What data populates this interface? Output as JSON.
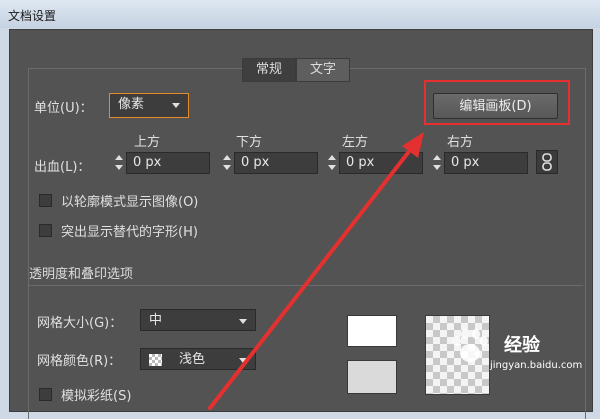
{
  "window": {
    "title": "文档设置"
  },
  "tabs": [
    {
      "label": "常规",
      "active": true
    },
    {
      "label": "文字",
      "active": false
    }
  ],
  "units": {
    "label": "单位(U)：",
    "value": "像素"
  },
  "edit_artboards_button": "编辑画板(D)",
  "bleed": {
    "label": "出血(L)：",
    "columns": [
      {
        "header": "上方",
        "value": "0 px"
      },
      {
        "header": "下方",
        "value": "0 px"
      },
      {
        "header": "左方",
        "value": "0 px"
      },
      {
        "header": "右方",
        "value": "0 px"
      }
    ],
    "link_icon": "chain-link-icon"
  },
  "checkboxes": [
    {
      "label": "以轮廓模式显示图像(O)",
      "checked": false
    },
    {
      "label": "突出显示替代的字形(H)",
      "checked": false
    }
  ],
  "transparency": {
    "section_title": "透明度和叠印选项",
    "grid_size": {
      "label": "网格大小(G)：",
      "value": "中"
    },
    "grid_color": {
      "label": "网格颜色(R)：",
      "value": "浅色"
    },
    "simulate_paper": {
      "label": "模拟彩纸(S)",
      "checked": false
    }
  },
  "watermark": {
    "brand": "经验",
    "url": "jingyan.baidu.com"
  },
  "colors": {
    "dialog_bg": "#535353",
    "field_bg": "#3d3d3d",
    "highlight_red": "#e53030",
    "focus_orange": "#e38b2b"
  }
}
